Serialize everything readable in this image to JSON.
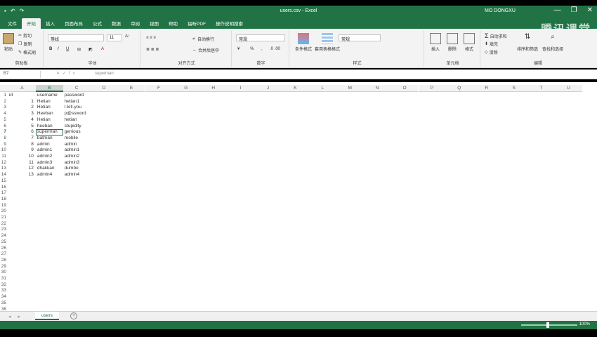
{
  "window": {
    "title": "users.csv - Excel",
    "user": "MO DONGXU",
    "watermark": "腾讯课堂",
    "minimize_glyph": "—",
    "restore_glyph": "❐",
    "close_glyph": "✕"
  },
  "ribbon": {
    "tabs": [
      "文件",
      "开始",
      "插入",
      "页面布局",
      "公式",
      "数据",
      "审阅",
      "视图",
      "帮助",
      "福昕PDF",
      "操作说明搜索"
    ],
    "active_tab": 1,
    "clipboard": {
      "paste": "粘贴",
      "cut": "剪切",
      "copy": "复制",
      "format_painter": "格式刷",
      "label": "剪贴板"
    },
    "font": {
      "name": "等线",
      "size": "11",
      "bold": "B",
      "italic": "I",
      "underline": "U",
      "label": "字体"
    },
    "alignment": {
      "wrap": "自动换行",
      "merge": "合并后居中",
      "label": "对齐方式"
    },
    "number": {
      "format": "常规",
      "percent": "%",
      "label": "数字"
    },
    "styles": {
      "conditional": "条件格式",
      "table": "套用表格格式",
      "cell_style": "常规",
      "label": "样式"
    },
    "cells": {
      "insert": "插入",
      "delete": "删除",
      "format": "格式",
      "label": "单元格"
    },
    "editing": {
      "autosum": "自动求和",
      "fill": "填充",
      "clear": "清除",
      "sort": "排序和筛选",
      "find": "查找和选择",
      "label": "编辑"
    }
  },
  "formula_bar": {
    "name_box": "B7",
    "fx": "fx",
    "content": "superman"
  },
  "sheet": {
    "columns": [
      "A",
      "B",
      "C",
      "D",
      "E",
      "F",
      "G",
      "H",
      "I",
      "J",
      "K",
      "L",
      "M",
      "N",
      "O",
      "P",
      "Q",
      "R",
      "S",
      "T",
      "U"
    ],
    "selected_column": "B",
    "selected_row": 7,
    "row_numbers": [
      1,
      2,
      3,
      4,
      5,
      6,
      7,
      8,
      9,
      10,
      11,
      12,
      13,
      14,
      15,
      16,
      17,
      18,
      19,
      20,
      21,
      22,
      23,
      24,
      25,
      26,
      27,
      28,
      29,
      30,
      31,
      32,
      33,
      34,
      35,
      36,
      37
    ],
    "rows": [
      [
        "id",
        "username",
        "password"
      ],
      [
        "1",
        "Hetian",
        "hetian1"
      ],
      [
        "2",
        "Hetian",
        "I-kill-you"
      ],
      [
        "3",
        "Heeban",
        "p@ssword"
      ],
      [
        "4",
        "Hetian",
        "hetian"
      ],
      [
        "5",
        "heeban",
        "stupidity"
      ],
      [
        "6",
        "superman",
        "genious"
      ],
      [
        "7",
        "batman",
        "mobile"
      ],
      [
        "8",
        "admin",
        "admin"
      ],
      [
        "9",
        "admin1",
        "admin1"
      ],
      [
        "10",
        "admin2",
        "admin2"
      ],
      [
        "11",
        "admin3",
        "admin3"
      ],
      [
        "12",
        "dhakkan",
        "dumbo"
      ],
      [
        "13",
        "admin4",
        "admin4"
      ]
    ],
    "tab_name": "users",
    "add_sheet": "+"
  },
  "status": {
    "zoom": "100%"
  },
  "colors": {
    "excel_green": "#217346"
  }
}
